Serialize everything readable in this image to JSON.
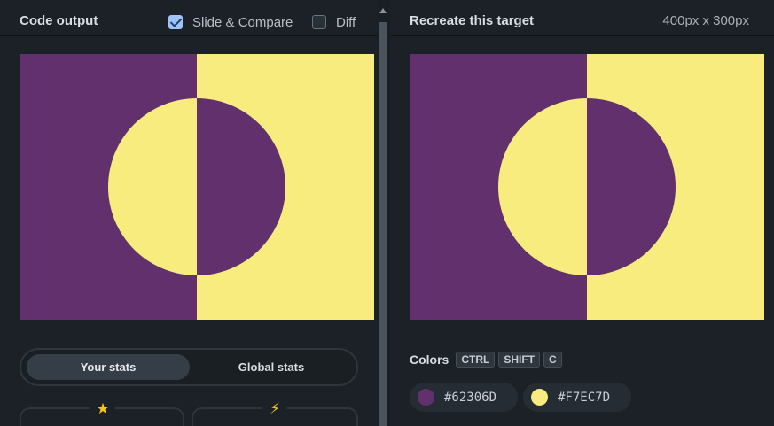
{
  "left": {
    "title": "Code output",
    "slide_compare": {
      "label": "Slide & Compare",
      "checked": true
    },
    "diff": {
      "label": "Diff",
      "checked": false
    },
    "stats": {
      "your": "Your stats",
      "global": "Global stats"
    },
    "cards": [
      {
        "icon": "star-icon",
        "glyph": "★"
      },
      {
        "icon": "bolt-icon",
        "glyph": "⚡"
      }
    ]
  },
  "right": {
    "title": "Recreate this target",
    "dims": "400px x 300px",
    "colors_label": "Colors",
    "shortcut": [
      "CTRL",
      "SHIFT",
      "C"
    ],
    "colors": [
      {
        "hex": "#62306D",
        "value": "#62306D"
      },
      {
        "hex": "#F7EC7D",
        "value": "#F7EC7D"
      }
    ]
  },
  "palette": {
    "purple": "#62306D",
    "yellow": "#F7EC7D"
  }
}
